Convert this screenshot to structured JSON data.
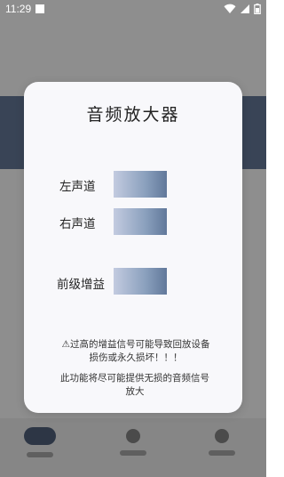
{
  "status_bar": {
    "time": "11:29"
  },
  "dialog": {
    "title": "音频放大器",
    "rows": [
      {
        "label": "左声道"
      },
      {
        "label": "右声道"
      },
      {
        "label": "前级增益"
      }
    ],
    "warning": "⚠过高的增益信号可能导致回放设备损伤或永久损坏！！！",
    "info": "此功能将尽可能提供无损的音频信号放大"
  },
  "colors": {
    "accent_gradient_start": "#c3cbe0",
    "accent_gradient_end": "#61789a",
    "dialog_background": "#f8f8fb",
    "background_accent": "#4a5870"
  },
  "icons": {
    "status": [
      "notification-icon",
      "wifi-icon",
      "cellular-signal-icon",
      "battery-icon"
    ],
    "bottom_nav": [
      "nav-home-icon",
      "nav-middle-icon",
      "nav-settings-icon"
    ]
  }
}
